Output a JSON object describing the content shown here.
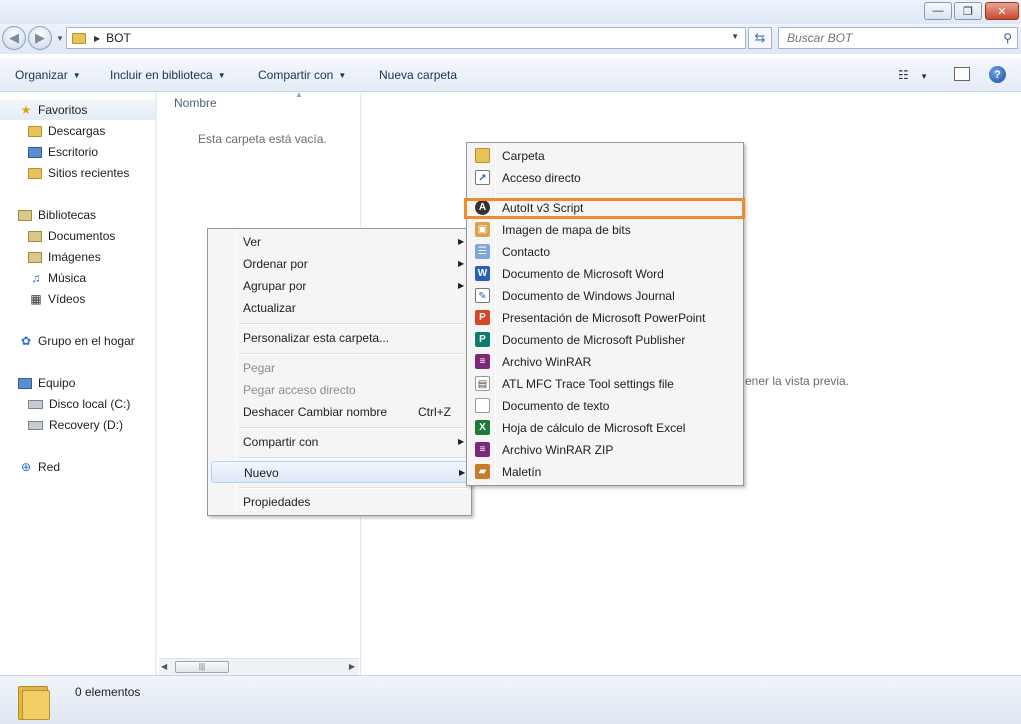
{
  "window": {
    "minimize_glyph": "—",
    "maximize_glyph": "❐",
    "close_glyph": "✕"
  },
  "address": {
    "folder": "BOT",
    "search_placeholder": "Buscar BOT"
  },
  "toolbar": {
    "organize": "Organizar",
    "include_library": "Incluir en biblioteca",
    "share_with": "Compartir con",
    "new_folder": "Nueva carpeta"
  },
  "nav": {
    "favorites": "Favoritos",
    "favorites_items": [
      "Descargas",
      "Escritorio",
      "Sitios recientes"
    ],
    "libraries": "Bibliotecas",
    "libraries_items": [
      "Documentos",
      "Imágenes",
      "Música",
      "Vídeos"
    ],
    "homegroup": "Grupo en el hogar",
    "computer": "Equipo",
    "computer_items": [
      "Disco local (C:)",
      "Recovery (D:)"
    ],
    "network": "Red"
  },
  "content": {
    "column_name": "Nombre",
    "empty_message": "Esta carpeta está vacía.",
    "preview_message": "ener la vista previa."
  },
  "status": {
    "count": "0 elementos"
  },
  "context_menu": {
    "ver": "Ver",
    "ordenar": "Ordenar por",
    "agrupar": "Agrupar por",
    "actualizar": "Actualizar",
    "personalizar": "Personalizar esta carpeta...",
    "pegar": "Pegar",
    "pegar_acceso": "Pegar acceso directo",
    "deshacer": "Deshacer Cambiar nombre",
    "deshacer_shortcut": "Ctrl+Z",
    "compartir": "Compartir con",
    "nuevo": "Nuevo",
    "propiedades": "Propiedades"
  },
  "submenu": {
    "items": [
      "Carpeta",
      "Acceso directo",
      "AutoIt v3 Script",
      "Imagen de mapa de bits",
      "Contacto",
      "Documento de Microsoft Word",
      "Documento de Windows Journal",
      "Presentación de Microsoft PowerPoint",
      "Documento de Microsoft Publisher",
      "Archivo WinRAR",
      "ATL MFC Trace Tool settings file",
      "Documento de texto",
      "Hoja de cálculo de Microsoft Excel",
      "Archivo WinRAR ZIP",
      "Maletín"
    ],
    "highlight_color": "#f08a2c"
  }
}
